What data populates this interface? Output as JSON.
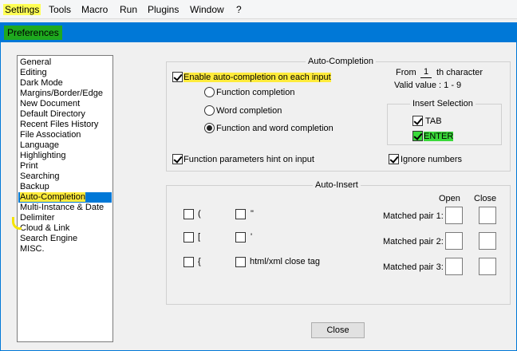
{
  "menubar": {
    "items": [
      "Settings",
      "Tools",
      "Macro",
      "Run",
      "Plugins",
      "Window",
      "?"
    ]
  },
  "window": {
    "title": "Preferences"
  },
  "categories": [
    "General",
    "Editing",
    "Dark Mode",
    "Margins/Border/Edge",
    "New Document",
    "Default Directory",
    "Recent Files History",
    "File Association",
    "Language",
    "Highlighting",
    "Print",
    "Searching",
    "Backup",
    "Auto-Completion",
    "Multi-Instance & Date",
    "Delimiter",
    "Cloud & Link",
    "Search Engine",
    "MISC."
  ],
  "selected_category": "Auto-Completion",
  "auto_completion": {
    "title": "Auto-Completion",
    "enable_label": "Enable auto-completion on each input",
    "enable_checked": true,
    "radio_function": "Function completion",
    "radio_word": "Word completion",
    "radio_both": "Function and word completion",
    "from_label": "From",
    "from_value": "1",
    "th_label": "th character",
    "valid_label": "Valid value : 1 - 9",
    "insert_selection_title": "Insert Selection",
    "tab_label": "TAB",
    "enter_label": "ENTER",
    "hint_label": "Function parameters hint on input",
    "ignore_label": "Ignore numbers"
  },
  "auto_insert": {
    "title": "Auto-Insert",
    "paren": "(",
    "bracket": "[",
    "brace": "{",
    "dquote": "\"",
    "squote": "'",
    "html_label": "html/xml close tag",
    "open_label": "Open",
    "close_label": "Close",
    "pair1": "Matched pair 1:",
    "pair2": "Matched pair 2:",
    "pair3": "Matched pair 3:"
  },
  "buttons": {
    "close": "Close"
  }
}
